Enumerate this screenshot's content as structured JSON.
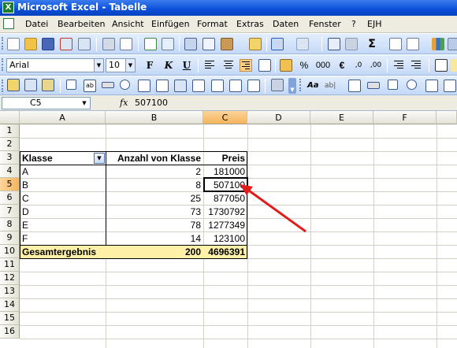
{
  "window": {
    "title": "Microsoft Excel - Tabelle"
  },
  "menu": [
    "Datei",
    "Bearbeiten",
    "Ansicht",
    "Einfügen",
    "Format",
    "Extras",
    "Daten",
    "Fenster",
    "?",
    "EJH"
  ],
  "format_bar": {
    "font": "Arial",
    "size": "10",
    "bold": "F",
    "italic": "K",
    "underline": "U",
    "percent": "%",
    "thousands": "000",
    "euro": "€"
  },
  "formula_bar": {
    "name_box": "C5",
    "fx": "fx",
    "value": "507100"
  },
  "columns": [
    "A",
    "B",
    "C",
    "D",
    "E",
    "F"
  ],
  "rows": [
    "1",
    "2",
    "3",
    "4",
    "5",
    "6",
    "7",
    "8",
    "9",
    "10",
    "11",
    "12",
    "13",
    "14",
    "15",
    "16"
  ],
  "pivot": {
    "headers": [
      "Klasse",
      "Anzahl von Klasse",
      "Preis"
    ],
    "rows": [
      [
        "A",
        "2",
        "181000"
      ],
      [
        "B",
        "8",
        "507100"
      ],
      [
        "C",
        "25",
        "877050"
      ],
      [
        "D",
        "73",
        "1730792"
      ],
      [
        "E",
        "78",
        "1277349"
      ],
      [
        "F",
        "14",
        "123100"
      ]
    ],
    "total": [
      "Gesamtergebnis",
      "200",
      "4696391"
    ]
  },
  "colors": {
    "title_bar": "#0a4ed8",
    "selected_header": "#f5b45c",
    "total_row": "#fff2a8",
    "arrow": "#e21b1b"
  }
}
